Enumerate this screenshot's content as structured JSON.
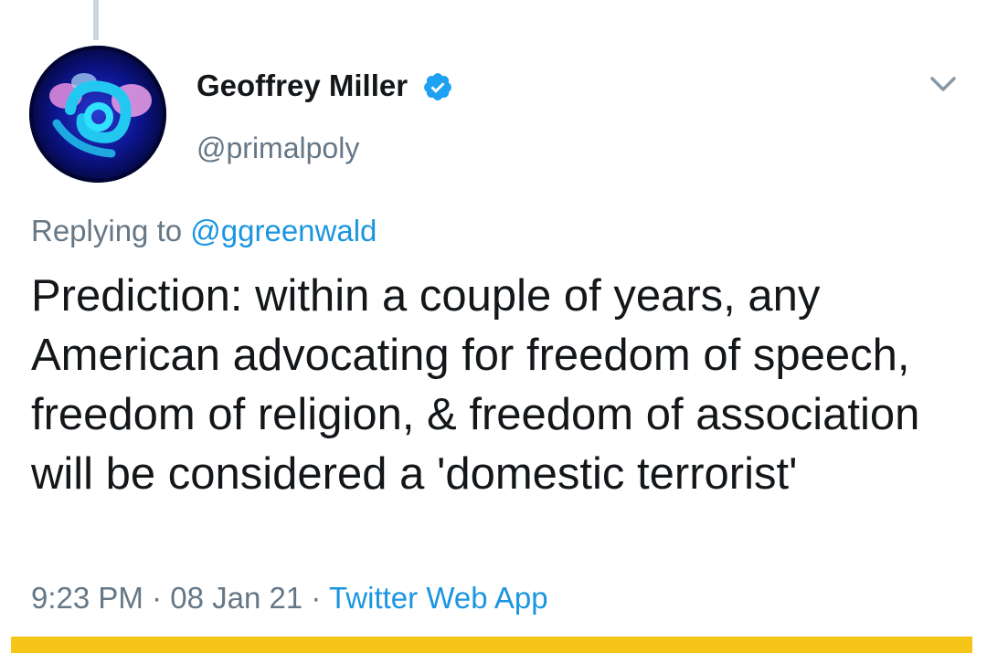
{
  "tweet": {
    "author": {
      "display_name": "Geoffrey Miller",
      "handle": "@primalpoly",
      "verified": true,
      "avatar_icon": "profile-avatar"
    },
    "reply_prefix": "Replying to",
    "reply_to": "@ggreenwald",
    "text": "Prediction: within a couple of years, any American advocating for freedom of speech, freedom of religion, & freedom of association will be considered a 'domestic terrorist'",
    "time": "9:23 PM",
    "date": "08 Jan 21",
    "source": "Twitter Web App",
    "separator": "·"
  },
  "icons": {
    "verified": "verified-badge-icon",
    "menu": "chevron-down-icon"
  },
  "colors": {
    "text_primary": "#14171a",
    "text_secondary": "#657786",
    "link": "#1b95e0",
    "verified": "#1da1f2",
    "highlight": "#f5c518"
  }
}
